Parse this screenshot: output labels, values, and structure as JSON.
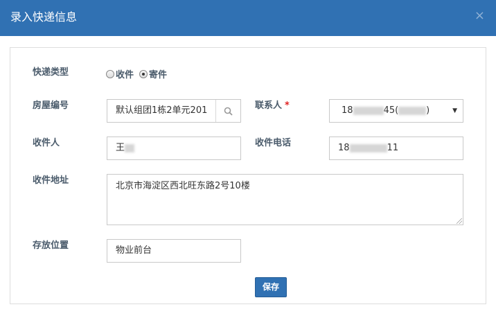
{
  "dialog": {
    "title": "录入快递信息",
    "close_glyph": "×"
  },
  "form": {
    "type_label": "快递类型",
    "type_options": [
      "收件",
      "寄件"
    ],
    "type_selected": "寄件",
    "room_label": "房屋编号",
    "room_value": "默认组团1栋2单元201",
    "contact_label": "联系人",
    "contact_required_mark": "*",
    "contact_value_prefix": "18",
    "contact_value_mid": "45(",
    "contact_value_suffix": ")",
    "receiver_label": "收件人",
    "receiver_value": "王",
    "phone_label": "收件电话",
    "phone_value_prefix": "18",
    "phone_value_suffix": "11",
    "address_label": "收件地址",
    "address_value": "北京市海淀区西北旺东路2号10楼",
    "storage_label": "存放位置",
    "storage_value": "物业前台",
    "save_label": "保存"
  },
  "icons": {
    "search": "search-icon",
    "close": "close-icon",
    "caret": "caret-down-icon"
  },
  "colors": {
    "header": "#3071b3",
    "button": "#3071b3",
    "required": "#e02222"
  }
}
